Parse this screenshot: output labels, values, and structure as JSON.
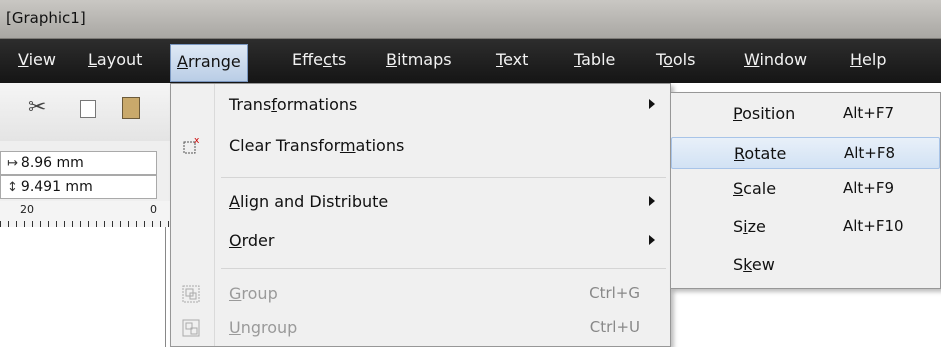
{
  "window": {
    "title": "[Graphic1]"
  },
  "menubar": {
    "items": [
      {
        "pre": "",
        "u": "V",
        "post": "iew"
      },
      {
        "pre": "",
        "u": "L",
        "post": "ayout"
      },
      {
        "pre": "",
        "u": "A",
        "post": "rrange",
        "active": true
      },
      {
        "pre": "Effe",
        "u": "c",
        "post": "ts"
      },
      {
        "pre": "",
        "u": "B",
        "post": "itmaps"
      },
      {
        "pre": "",
        "u": "T",
        "post": "ext"
      },
      {
        "pre": "",
        "u": "T",
        "post": "able"
      },
      {
        "pre": "T",
        "u": "o",
        "post": "ols"
      },
      {
        "pre": "",
        "u": "W",
        "post": "indow"
      },
      {
        "pre": "",
        "u": "H",
        "post": "elp"
      }
    ]
  },
  "toolbar": {
    "icons": [
      "scissors-icon",
      "copy-icon",
      "paste-icon"
    ]
  },
  "properties": {
    "width_value": "8.96 mm",
    "height_value": "9.491 mm"
  },
  "ruler": {
    "labels": [
      "20",
      "0"
    ]
  },
  "arrange_menu": {
    "items": [
      {
        "pre": "Trans",
        "u": "f",
        "post": "ormations",
        "submenu": true,
        "hover": false
      },
      {
        "pre": "Clear Transfor",
        "u": "m",
        "post": "ations",
        "icon": "clear-transformations-icon"
      },
      {
        "pre": "",
        "u": "A",
        "post": "lign and Distribute",
        "submenu": true
      },
      {
        "pre": "",
        "u": "O",
        "post": "rder",
        "submenu": true
      },
      {
        "pre": "",
        "u": "G",
        "post": "roup",
        "shortcut": "Ctrl+G",
        "disabled": true,
        "icon": "group-icon"
      },
      {
        "pre": "",
        "u": "U",
        "post": "ngroup",
        "shortcut": "Ctrl+U",
        "disabled": true,
        "icon": "ungroup-icon"
      }
    ]
  },
  "transformations_submenu": {
    "items": [
      {
        "pre": "",
        "u": "P",
        "post": "osition",
        "shortcut": "Alt+F7"
      },
      {
        "pre": "",
        "u": "R",
        "post": "otate",
        "shortcut": "Alt+F8",
        "hover": true
      },
      {
        "pre": "",
        "u": "S",
        "post": "cale",
        "shortcut": "Alt+F9"
      },
      {
        "pre": "S",
        "u": "i",
        "post": "ze",
        "shortcut": "Alt+F10"
      },
      {
        "pre": "S",
        "u": "k",
        "post": "ew"
      }
    ]
  },
  "colors": {
    "menubar_bg": "#1f1f1f",
    "highlight_border": "#a8c4e8",
    "disabled_text": "#9a9a9a"
  }
}
